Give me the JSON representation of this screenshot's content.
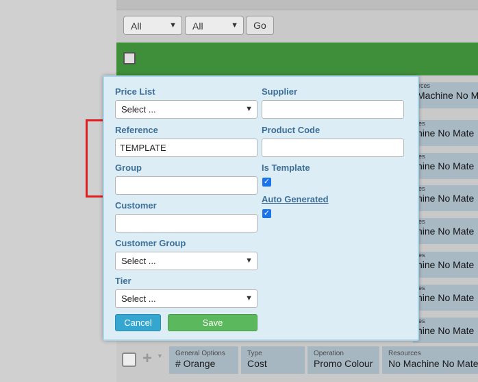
{
  "filters": {
    "select1_value": "All",
    "select2_value": "All",
    "go_label": "Go"
  },
  "background_cards": {
    "label_partial": "rces",
    "label_partial_short": "es",
    "value_partial_1": "Machine No Mat",
    "value_partial": "hine No Mate"
  },
  "bottom_row": {
    "cells": [
      {
        "label": "General Options",
        "value": "# Orange"
      },
      {
        "label": "Type",
        "value": "Cost"
      },
      {
        "label": "Operation",
        "value": "Promo Colour"
      },
      {
        "label": "Resources",
        "value": "No Machine No Mate"
      }
    ]
  },
  "modal": {
    "price_list": {
      "label": "Price List",
      "value": "Select ..."
    },
    "supplier": {
      "label": "Supplier",
      "value": ""
    },
    "reference": {
      "label": "Reference",
      "value": "TEMPLATE"
    },
    "product_code": {
      "label": "Product Code",
      "value": ""
    },
    "group": {
      "label": "Group",
      "value": ""
    },
    "is_template": {
      "label": "Is Template",
      "checked": true
    },
    "auto_generated": {
      "label": "Auto Generated",
      "checked": true
    },
    "customer": {
      "label": "Customer",
      "value": ""
    },
    "customer_group": {
      "label": "Customer Group",
      "value": "Select ..."
    },
    "tier": {
      "label": "Tier",
      "value": "Select ..."
    },
    "cancel_label": "Cancel",
    "save_label": "Save"
  },
  "colors": {
    "modal_bg": "#dcedf6",
    "label": "#3d6f98",
    "green_bar": "#3f8f3a",
    "cancel": "#35a6cf",
    "save": "#5cb85c",
    "annotation": "#e02020"
  }
}
